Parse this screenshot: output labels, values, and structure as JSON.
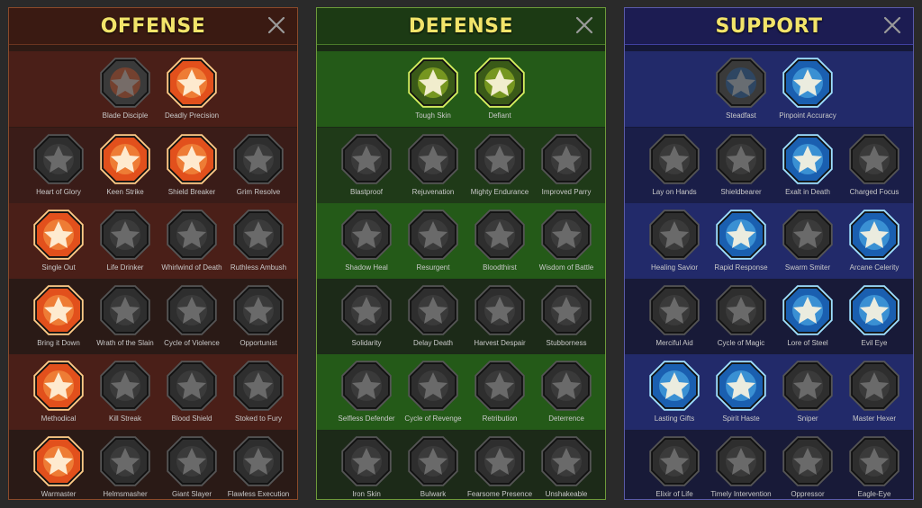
{
  "panels": [
    {
      "key": "offense",
      "title": "OFFENSE",
      "theme": {
        "active_fill": "#e2501c",
        "active_inner": "#f7a04a",
        "active_stroke": "#ffcc88"
      },
      "rows": [
        [
          {
            "label": "Blade Disciple",
            "active": false,
            "partial": true,
            "icon": "crossed-swords-icon"
          },
          {
            "label": "Deadly Precision",
            "active": true,
            "icon": "slash-burst-icon"
          }
        ],
        [
          {
            "label": "Heart of Glory",
            "active": false,
            "icon": "horned-figure-icon"
          },
          {
            "label": "Keen Strike",
            "active": true,
            "icon": "spear-strike-icon"
          },
          {
            "label": "Shield Breaker",
            "active": true,
            "icon": "broken-shield-icon"
          },
          {
            "label": "Grim Resolve",
            "active": false,
            "icon": "dagger-heart-icon"
          }
        ],
        [
          {
            "label": "Single Out",
            "active": true,
            "icon": "targeted-figure-icon"
          },
          {
            "label": "Life Drinker",
            "active": false,
            "icon": "fanged-mouth-icon"
          },
          {
            "label": "Whirlwind of Death",
            "active": false,
            "icon": "whirlwind-skull-icon"
          },
          {
            "label": "Ruthless Ambush",
            "active": false,
            "icon": "ambush-hand-icon"
          }
        ],
        [
          {
            "label": "Bring it Down",
            "active": true,
            "icon": "sword-heart-icon"
          },
          {
            "label": "Wrath of the Slain",
            "active": false,
            "icon": "raised-fist-icon"
          },
          {
            "label": "Cycle of Violence",
            "active": false,
            "icon": "axe-icon"
          },
          {
            "label": "Opportunist",
            "active": false,
            "icon": "chains-icon"
          }
        ],
        [
          {
            "label": "Methodical",
            "active": true,
            "icon": "arrows-target-icon"
          },
          {
            "label": "Kill Streak",
            "active": false,
            "icon": "skull-icon"
          },
          {
            "label": "Blood Shield",
            "active": false,
            "icon": "sword-shield-icon"
          },
          {
            "label": "Stoked to Fury",
            "active": false,
            "icon": "furious-figure-icon"
          }
        ],
        [
          {
            "label": "Warmaster",
            "active": true,
            "icon": "sparkle-sword-icon"
          },
          {
            "label": "Helmsmasher",
            "active": false,
            "icon": "helmet-icon"
          },
          {
            "label": "Giant Slayer",
            "active": false,
            "icon": "giant-icon"
          },
          {
            "label": "Flawless Execution",
            "active": false,
            "icon": "executioner-skull-icon"
          }
        ]
      ]
    },
    {
      "key": "defense",
      "title": "DEFENSE",
      "theme": {
        "active_fill": "#3a5a18",
        "active_inner": "#a8c828",
        "active_stroke": "#d8f060"
      },
      "rows": [
        [
          {
            "label": "Tough Skin",
            "active": true,
            "icon": "scales-icon"
          },
          {
            "label": "Defiant",
            "active": true,
            "icon": "raised-fist-icon"
          }
        ],
        [
          {
            "label": "Blastproof",
            "active": false,
            "icon": "chevron-shield-icon"
          },
          {
            "label": "Rejuvenation",
            "active": false,
            "icon": "heart-hand-icon"
          },
          {
            "label": "Mighty Endurance",
            "active": false,
            "icon": "armored-torso-icon"
          },
          {
            "label": "Improved Parry",
            "active": false,
            "icon": "parry-blades-icon"
          }
        ],
        [
          {
            "label": "Shadow Heal",
            "active": false,
            "icon": "shadow-figure-icon"
          },
          {
            "label": "Resurgent",
            "active": false,
            "icon": "knight-shield-icon"
          },
          {
            "label": "Bloodthirst",
            "active": false,
            "icon": "skull-heart-icon"
          },
          {
            "label": "Wisdom of Battle",
            "active": false,
            "icon": "haloed-head-icon"
          }
        ],
        [
          {
            "label": "Solidarity",
            "active": false,
            "icon": "crowd-icon"
          },
          {
            "label": "Delay Death",
            "active": false,
            "icon": "hourglass-icon"
          },
          {
            "label": "Harvest Despair",
            "active": false,
            "icon": "open-hand-icon"
          },
          {
            "label": "Stubborness",
            "active": false,
            "icon": "bull-head-icon"
          }
        ],
        [
          {
            "label": "Selfless Defender",
            "active": false,
            "icon": "dashing-figure-icon"
          },
          {
            "label": "Cycle of Revenge",
            "active": false,
            "icon": "drops-icon"
          },
          {
            "label": "Retribution",
            "active": false,
            "icon": "spiked-skull-icon"
          },
          {
            "label": "Deterrence",
            "active": false,
            "icon": "swirl-hand-icon"
          }
        ],
        [
          {
            "label": "Iron Skin",
            "active": false,
            "icon": "crowned-figure-icon"
          },
          {
            "label": "Bulwark",
            "active": false,
            "icon": "bulwark-shield-icon"
          },
          {
            "label": "Fearsome Presence",
            "active": false,
            "icon": "bearded-face-icon"
          },
          {
            "label": "Unshakeable",
            "active": false,
            "icon": "strong-figure-icon"
          }
        ]
      ]
    },
    {
      "key": "support",
      "title": "SUPPORT",
      "theme": {
        "active_fill": "#1a5fb0",
        "active_inner": "#55b8f0",
        "active_stroke": "#9fe0ff"
      },
      "rows": [
        [
          {
            "label": "Steadfast",
            "active": false,
            "partial": true,
            "icon": "heart-plus-icon"
          },
          {
            "label": "Pinpoint Accuracy",
            "active": true,
            "icon": "target-hand-icon"
          }
        ],
        [
          {
            "label": "Lay on Hands",
            "active": false,
            "icon": "praying-hands-icon"
          },
          {
            "label": "Shieldbearer",
            "active": false,
            "icon": "dome-shield-icon"
          },
          {
            "label": "Exalt in Death",
            "active": true,
            "icon": "flaming-skull-icon"
          },
          {
            "label": "Charged Focus",
            "active": false,
            "icon": "pointing-hand-icon"
          }
        ],
        [
          {
            "label": "Healing Savior",
            "active": false,
            "icon": "radiant-figure-icon"
          },
          {
            "label": "Rapid Response",
            "active": true,
            "icon": "lightning-icon"
          },
          {
            "label": "Swarm Smiter",
            "active": false,
            "icon": "cracks-icon"
          },
          {
            "label": "Arcane Celerity",
            "active": true,
            "icon": "speed-figure-icon"
          }
        ],
        [
          {
            "label": "Merciful Aid",
            "active": false,
            "icon": "chained-heart-icon"
          },
          {
            "label": "Cycle of Magic",
            "active": false,
            "icon": "comet-icon"
          },
          {
            "label": "Lore of Steel",
            "active": true,
            "icon": "open-book-icon"
          },
          {
            "label": "Evil Eye",
            "active": true,
            "icon": "glaring-eyes-icon"
          }
        ],
        [
          {
            "label": "Lasting Gifts",
            "active": true,
            "icon": "compass-star-icon"
          },
          {
            "label": "Spirit Haste",
            "active": true,
            "icon": "winged-boot-icon"
          },
          {
            "label": "Sniper",
            "active": false,
            "icon": "eye-icon"
          },
          {
            "label": "Master Hexer",
            "active": false,
            "icon": "voodoo-doll-icon"
          }
        ],
        [
          {
            "label": "Elixir of Life",
            "active": false,
            "icon": "potion-icon"
          },
          {
            "label": "Timely Intervention",
            "active": false,
            "icon": "winged-skull-icon"
          },
          {
            "label": "Oppressor",
            "active": false,
            "icon": "stomp-icon"
          },
          {
            "label": "Eagle-Eye",
            "active": false,
            "icon": "eagle-head-icon"
          }
        ]
      ]
    }
  ]
}
